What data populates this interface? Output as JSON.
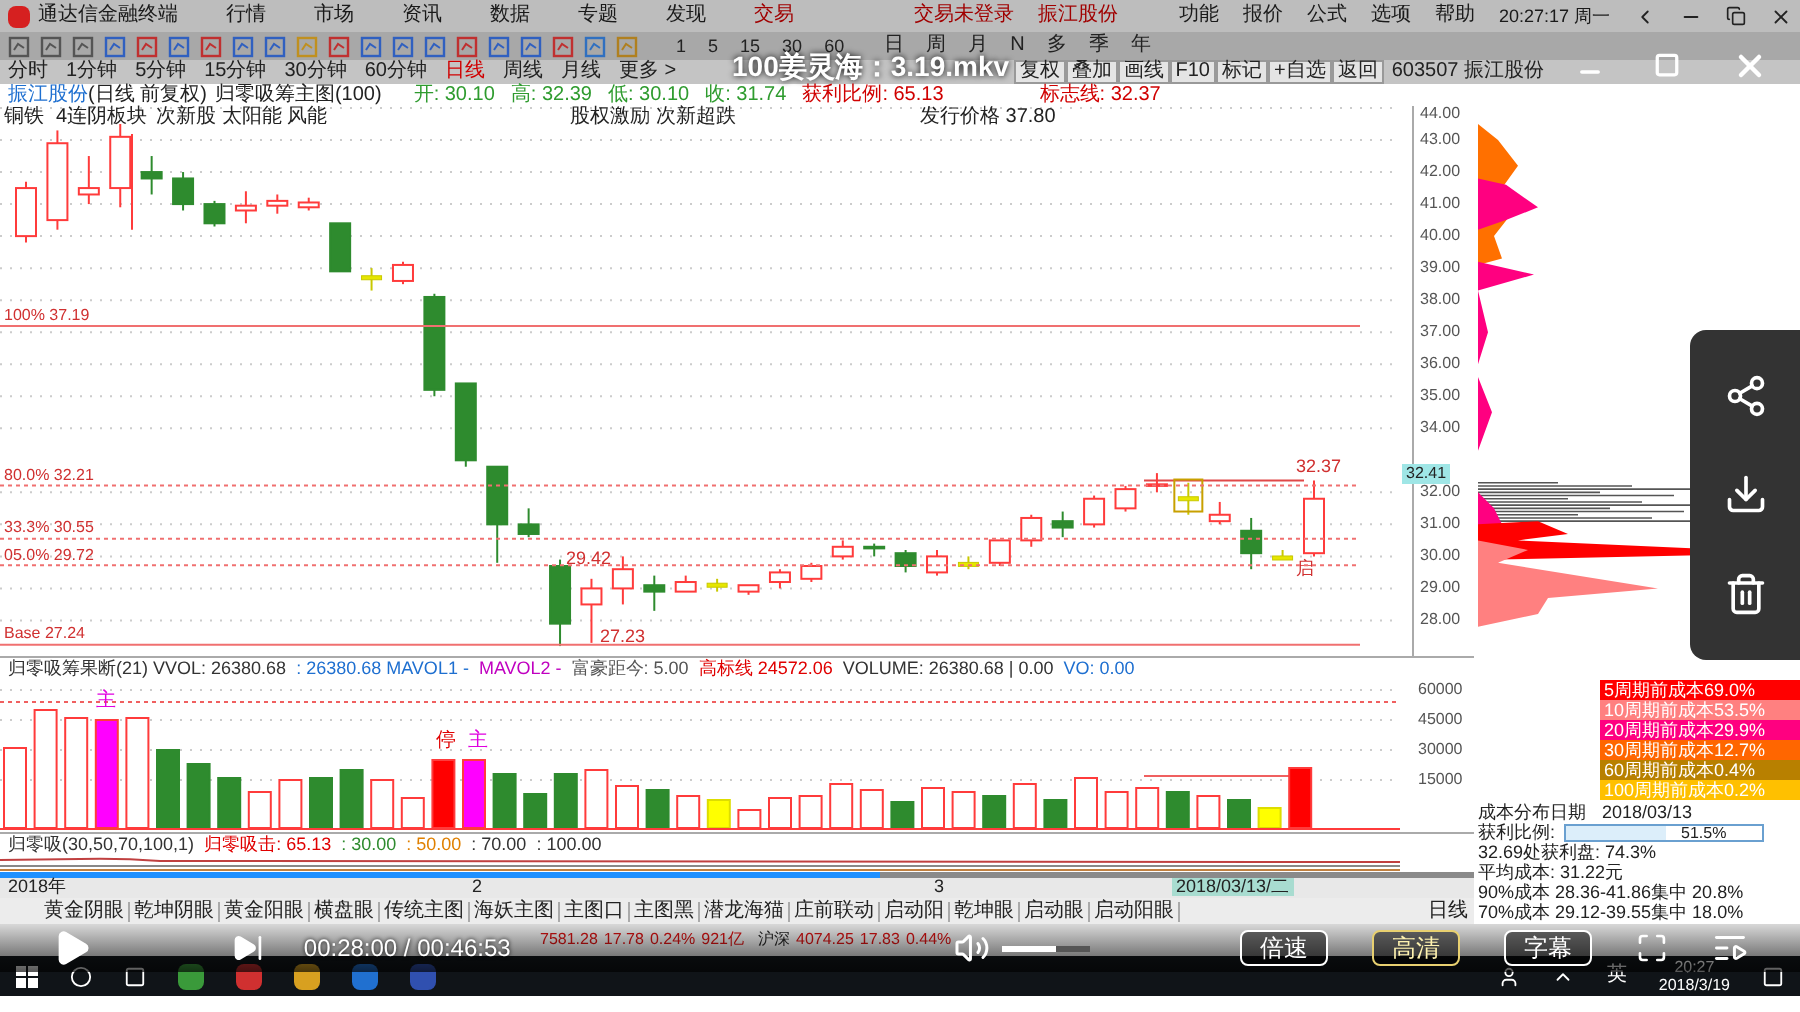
{
  "menu_bar": {
    "app_name": "通达信金融终端",
    "items": [
      "行情",
      "市场",
      "资讯",
      "数据",
      "专题",
      "发现",
      "交易"
    ],
    "notices": [
      "交易未登录",
      "振江股份"
    ],
    "right_items": [
      "功能",
      "报价",
      "公式",
      "选项",
      "帮助"
    ],
    "clock": "20:27:17 周一"
  },
  "toolbar": {
    "periods": [
      "1",
      "5",
      "15",
      "30",
      "60"
    ],
    "cycles": [
      "日",
      "周",
      "月",
      "N",
      "多",
      "季",
      "年"
    ]
  },
  "period_tabs": [
    {
      "label": "分时",
      "selected": false
    },
    {
      "label": "1分钟",
      "selected": false
    },
    {
      "label": "5分钟",
      "selected": false
    },
    {
      "label": "15分钟",
      "selected": false
    },
    {
      "label": "30分钟",
      "selected": false
    },
    {
      "label": "60分钟",
      "selected": false
    },
    {
      "label": "日线",
      "selected": true
    },
    {
      "label": "周线",
      "selected": false
    },
    {
      "label": "月线",
      "selected": false
    },
    {
      "label": "更多 >",
      "selected": false
    }
  ],
  "chart_buttons": [
    "复权",
    "叠加",
    "画线",
    "F10",
    "标记",
    "+自选",
    "返回"
  ],
  "stock": "603507 振江股份",
  "video_title": "100姜灵海：3.19.mkv",
  "chart_header": {
    "name": "振江股份",
    "mode": "(日线 前复权)",
    "formula": "归零吸筹主图(100)",
    "open": "开: 30.10",
    "high": "高: 32.39",
    "low": "低: 30.10",
    "close": "收: 31.74",
    "profit": "获利比例: 65.13",
    "mark": "标志线: 32.37"
  },
  "chart_annotations": [
    "铜铁",
    "4连阴板块",
    "次新股 太阳能 风能",
    "股权激励 次新超跌",
    "发行价格 37.80"
  ],
  "price_marks": [
    "29.42",
    "27.23",
    "32.37",
    "启"
  ],
  "level_lines": [
    {
      "label": "100% 37.19"
    },
    {
      "label": "80.0% 32.21"
    },
    {
      "label": "33.3% 30.55"
    },
    {
      "label": "05.0% 29.72"
    },
    {
      "label": "Base 27.24"
    }
  ],
  "price_chart": {
    "chart_data": {
      "type": "candlestick",
      "grid": true,
      "ylim": [
        26.89,
        44
      ],
      "yticks": [
        {
          "value": 44,
          "label": "44.00"
        },
        {
          "value": 43,
          "label": "43.00"
        },
        {
          "value": 42,
          "label": "42.00"
        },
        {
          "value": 41,
          "label": "41.00"
        },
        {
          "value": 40,
          "label": "40.00"
        },
        {
          "value": 39,
          "label": "39.00"
        },
        {
          "value": 38,
          "label": "38.00"
        },
        {
          "value": 37,
          "label": "37.00"
        },
        {
          "value": 36,
          "label": "36.00"
        },
        {
          "value": 35,
          "label": "35.00"
        },
        {
          "value": 34,
          "label": "34.00"
        },
        {
          "value": 32,
          "label": "32.00"
        },
        {
          "value": 31,
          "label": "31.00"
        },
        {
          "value": 30,
          "label": "30.00"
        },
        {
          "value": 29,
          "label": "29.00"
        },
        {
          "value": 28,
          "label": "28.00"
        }
      ],
      "ohlc": [
        [
          40.0,
          41.7,
          39.8,
          41.5
        ],
        [
          40.5,
          43.3,
          40.2,
          42.9
        ],
        [
          41.3,
          42.5,
          41.0,
          41.5
        ],
        [
          41.5,
          43.5,
          40.9,
          43.1
        ],
        [
          42.0,
          42.5,
          41.3,
          41.8
        ],
        [
          41.8,
          42.0,
          40.8,
          41.0
        ],
        [
          41.0,
          41.1,
          40.3,
          40.4
        ],
        [
          40.8,
          41.4,
          40.4,
          40.95
        ],
        [
          40.95,
          41.3,
          40.7,
          41.1
        ],
        [
          40.9,
          41.2,
          40.8,
          41.05
        ],
        [
          40.4,
          40.4,
          38.9,
          38.9
        ],
        [
          38.7,
          39.0,
          38.3,
          38.7
        ],
        [
          38.6,
          39.2,
          38.5,
          39.1
        ],
        [
          38.1,
          38.2,
          35.0,
          35.2
        ],
        [
          35.4,
          35.4,
          32.8,
          33.0
        ],
        [
          32.8,
          32.8,
          29.8,
          31.0
        ],
        [
          31.0,
          31.5,
          30.6,
          30.7
        ],
        [
          29.7,
          29.9,
          27.2,
          27.9
        ],
        [
          28.5,
          29.3,
          27.3,
          29.0
        ],
        [
          29.0,
          30.0,
          28.5,
          29.6
        ],
        [
          29.1,
          29.4,
          28.3,
          28.9
        ],
        [
          28.9,
          29.4,
          28.9,
          29.2
        ],
        [
          29.1,
          29.3,
          28.9,
          29.1
        ],
        [
          28.9,
          29.1,
          28.8,
          29.1
        ],
        [
          29.2,
          29.6,
          29.0,
          29.5
        ],
        [
          29.3,
          29.8,
          29.2,
          29.7
        ],
        [
          30.0,
          30.5,
          29.9,
          30.3
        ],
        [
          30.3,
          30.4,
          30.0,
          30.25
        ],
        [
          30.1,
          30.2,
          29.5,
          29.7
        ],
        [
          29.5,
          30.2,
          29.4,
          30.0
        ],
        [
          29.75,
          30.0,
          29.6,
          29.75
        ],
        [
          29.8,
          30.5,
          29.7,
          30.5
        ],
        [
          30.5,
          31.3,
          30.3,
          31.2
        ],
        [
          31.1,
          31.4,
          30.6,
          30.9
        ],
        [
          31.0,
          31.9,
          30.9,
          31.8
        ],
        [
          31.5,
          32.2,
          31.4,
          32.1
        ],
        [
          32.2,
          32.6,
          32.0,
          32.25
        ],
        [
          31.8,
          32.3,
          31.3,
          31.8
        ],
        [
          31.1,
          31.7,
          31.0,
          31.3
        ],
        [
          30.8,
          31.2,
          29.6,
          30.1
        ],
        [
          29.95,
          30.2,
          29.9,
          29.95
        ],
        [
          30.1,
          32.37,
          30.0,
          31.8
        ]
      ]
    }
  },
  "current_price": "32.41",
  "volume_panel": {
    "legend": [
      {
        "text": "归零吸筹果断(21) VVOL: 26380.68",
        "color": "#333333"
      },
      {
        "text": ": 26380.68 MAVOL1 -",
        "color": "#1e6fd0"
      },
      {
        "text": "MAVOL2 -",
        "color": "#c000c0"
      },
      {
        "text": "富豪距今: 5.00",
        "color": "#555555"
      },
      {
        "text": "高标线 24572.06",
        "color": "#e00000"
      },
      {
        "text": "VOLUME: 26380.68 | 0.00",
        "color": "#333333"
      },
      {
        "text": "VO: 0.00",
        "color": "#1e6fd0"
      }
    ],
    "axis": [
      "60000",
      "45000",
      "30000",
      "15000"
    ],
    "bar_marks": [
      "主",
      "停",
      "主"
    ]
  },
  "indicator": {
    "legend": [
      {
        "text": "归零吸(30,50,70,100,1)",
        "color": "#333333"
      },
      {
        "text": "归零吸击: 65.13",
        "color": "#e00000"
      },
      {
        "text": ": 30.00",
        "color": "#2e8b2e"
      },
      {
        "text": ": 50.00",
        "color": "#e08000"
      },
      {
        "text": ": 70.00",
        "color": "#333333"
      },
      {
        "text": ": 100.00",
        "color": "#333333"
      }
    ]
  },
  "timeline": {
    "labels": [
      "2018年",
      "2",
      "3"
    ],
    "date_marker": "2018/03/13/二"
  },
  "bottom_tabs": [
    "黄金阴眼",
    "乾坤阴眼",
    "黄金阳眼",
    "横盘眼",
    "传统主图",
    "海妖主图",
    "主图口",
    "主图黑",
    "潜龙海猫",
    "庄前联动",
    "启动阳",
    "乾坤眼",
    "启动眼",
    "启动阳眼"
  ],
  "period_label": "日线",
  "ticker": [
    "7581.28",
    "17.78",
    "0.24%",
    "921亿",
    "沪深",
    "4074.25",
    "17.83",
    "0.44%"
  ],
  "cost_legend": [
    {
      "label": "5周期前成本69.0%",
      "color": "#ff0000"
    },
    {
      "label": "10周期前成本53.5%",
      "color": "#ff8080"
    },
    {
      "label": "20周期前成本29.9%",
      "color": "#ff0080"
    },
    {
      "label": "30周期前成本12.7%",
      "color": "#ff6600"
    },
    {
      "label": "60周期前成本0.4%",
      "color": "#b88000"
    },
    {
      "label": "100周期前成本0.2%",
      "color": "#ffc000"
    }
  ],
  "cost_info": {
    "date_label": "成本分布日期",
    "date": "2018/03/13",
    "profit_label": "获利比例:",
    "profit_value": "51.5%",
    "level": 0.515,
    "lines": [
      "32.69处获利盘: 74.3%",
      "平均成本: 31.22元",
      "90%成本 28.36-41.86集中 20.8%",
      "70%成本 29.12-39.55集中 18.0%"
    ]
  },
  "player": {
    "progress": {
      "level": 0.597
    },
    "time": "00:28:00 / 00:46:53",
    "volume": {
      "level": 0.6
    },
    "buttons": [
      {
        "label": "倍速",
        "selected": false
      },
      {
        "label": "高清",
        "selected": true
      },
      {
        "label": "字幕",
        "selected": false
      }
    ]
  },
  "taskbar": {
    "ime": "英",
    "time": "20:27",
    "date": "2018/3/19"
  }
}
